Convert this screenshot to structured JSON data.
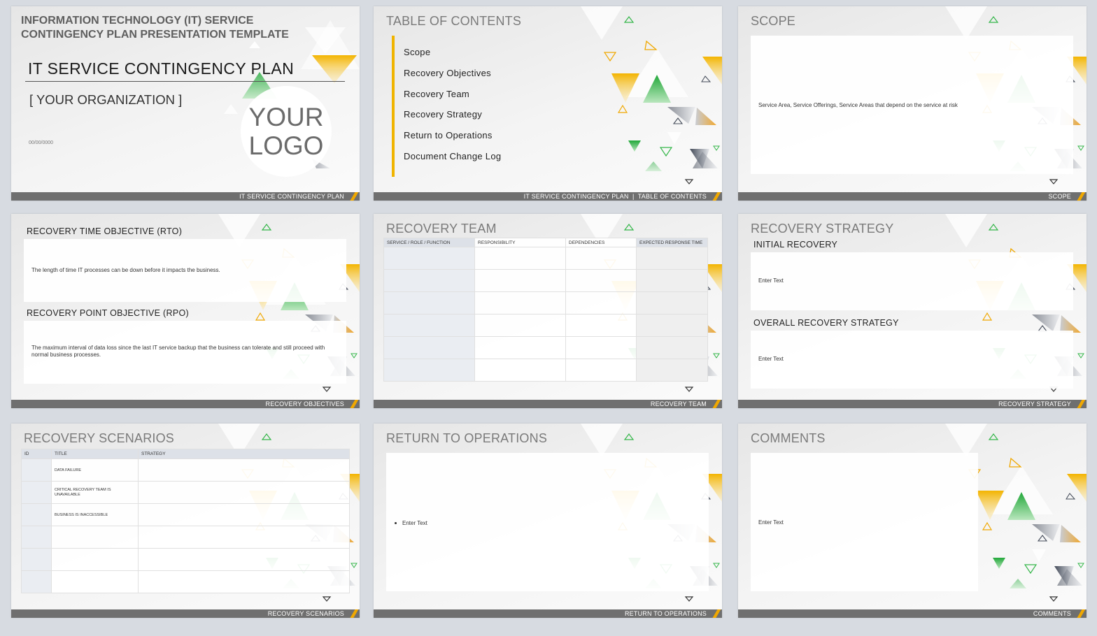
{
  "colors": {
    "accent_yellow": "#f0b400",
    "accent_green": "#35b64a",
    "footer_gray": "#6f6f6f",
    "table_header": "#dde1e8"
  },
  "slide1": {
    "heading": "INFORMATION TECHNOLOGY (IT) SERVICE CONTINGENCY PLAN PRESENTATION TEMPLATE",
    "title": "IT SERVICE CONTINGENCY PLAN",
    "org": "[ YOUR ORGANIZATION ]",
    "date": "00/00/0000",
    "logo_line1": "YOUR",
    "logo_line2": "LOGO",
    "footer": "IT SERVICE CONTINGENCY PLAN"
  },
  "slide2": {
    "title": "TABLE OF CONTENTS",
    "items": [
      "Scope",
      "Recovery Objectives",
      "Recovery Team",
      "Recovery Strategy",
      "Return to Operations",
      "Document Change Log"
    ],
    "footer": "IT SERVICE CONTINGENCY PLAN  |  TABLE OF CONTENTS"
  },
  "slide3": {
    "title": "SCOPE",
    "text": "Service Area, Service Offerings, Service Areas that depend on the service at risk",
    "footer": "SCOPE"
  },
  "slide4": {
    "rto_label": "RECOVERY TIME OBJECTIVE (RTO)",
    "rto_text": "The length of time IT processes can be down before it impacts the business.",
    "rpo_label": "RECOVERY POINT OBJECTIVE (RPO)",
    "rpo_text": "The maximum interval of data loss since the last IT service backup that the business can tolerate and still proceed with normal business processes.",
    "footer": "RECOVERY OBJECTIVES"
  },
  "slide5": {
    "title": "RECOVERY TEAM",
    "columns": [
      "SERVICE / ROLE / FUNCTION",
      "RESPONSIBILITY",
      "DEPENDENCIES",
      "EXPECTED RESPONSE TIME"
    ],
    "footer": "RECOVERY TEAM"
  },
  "slide6": {
    "title": "RECOVERY STRATEGY",
    "initial_label": "INITIAL RECOVERY",
    "initial_text": "Enter Text",
    "overall_label": "OVERALL RECOVERY STRATEGY",
    "overall_text": "Enter Text",
    "footer": "RECOVERY STRATEGY"
  },
  "slide7": {
    "title": "RECOVERY SCENARIOS",
    "columns": [
      "ID",
      "TITLE",
      "STRATEGY"
    ],
    "rows": [
      {
        "id": "",
        "title": "DATA FAILURE",
        "strategy": ""
      },
      {
        "id": "",
        "title": "CRITICAL RECOVERY TEAM IS UNAVAILABLE",
        "strategy": ""
      },
      {
        "id": "",
        "title": "BUSINESS IS INACCESSIBLE",
        "strategy": ""
      },
      {
        "id": "",
        "title": "",
        "strategy": ""
      },
      {
        "id": "",
        "title": "",
        "strategy": ""
      },
      {
        "id": "",
        "title": "",
        "strategy": ""
      }
    ],
    "footer": "RECOVERY SCENARIOS"
  },
  "slide8": {
    "title": "RETURN TO OPERATIONS",
    "bullet": "Enter Text",
    "footer": "RETURN TO OPERATIONS"
  },
  "slide9": {
    "title": "COMMENTS",
    "text": "Enter Text",
    "footer": "COMMENTS"
  }
}
